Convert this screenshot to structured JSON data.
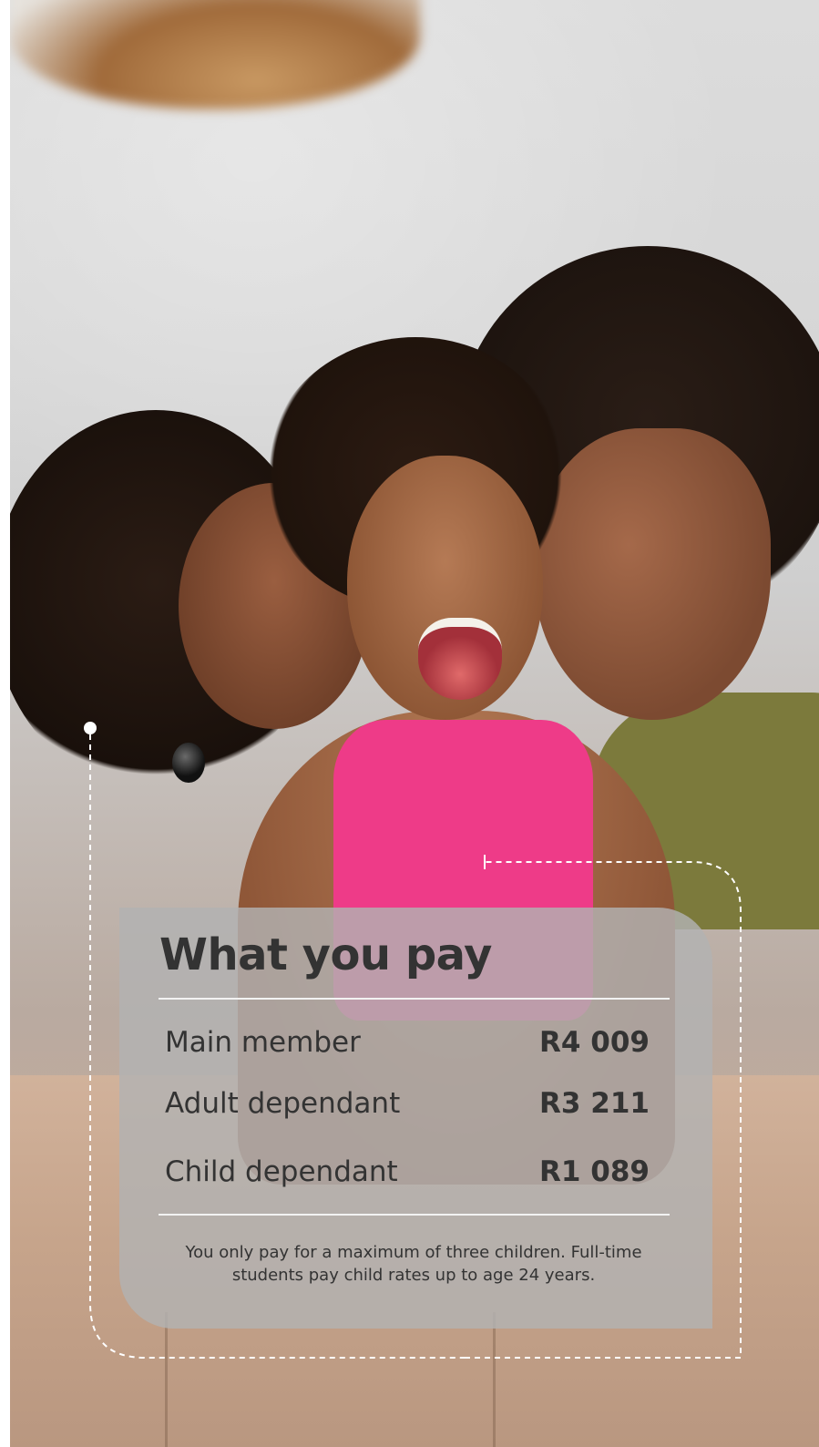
{
  "panel": {
    "title": "What you pay",
    "rows": [
      {
        "label": "Main member",
        "value": "R4 009"
      },
      {
        "label": "Adult dependant",
        "value": "R3 211"
      },
      {
        "label": "Child dependant",
        "value": "R1 089"
      }
    ],
    "footnote": "You only pay for a maximum of three children. Full-time students pay child rates up to age 24 years."
  },
  "photo": {
    "subject": "family-photo"
  },
  "colors": {
    "text": "#333333",
    "panel_background": "#b2b2b2",
    "rule": "#f2f2f2",
    "dashed_line": "#ffffff"
  }
}
